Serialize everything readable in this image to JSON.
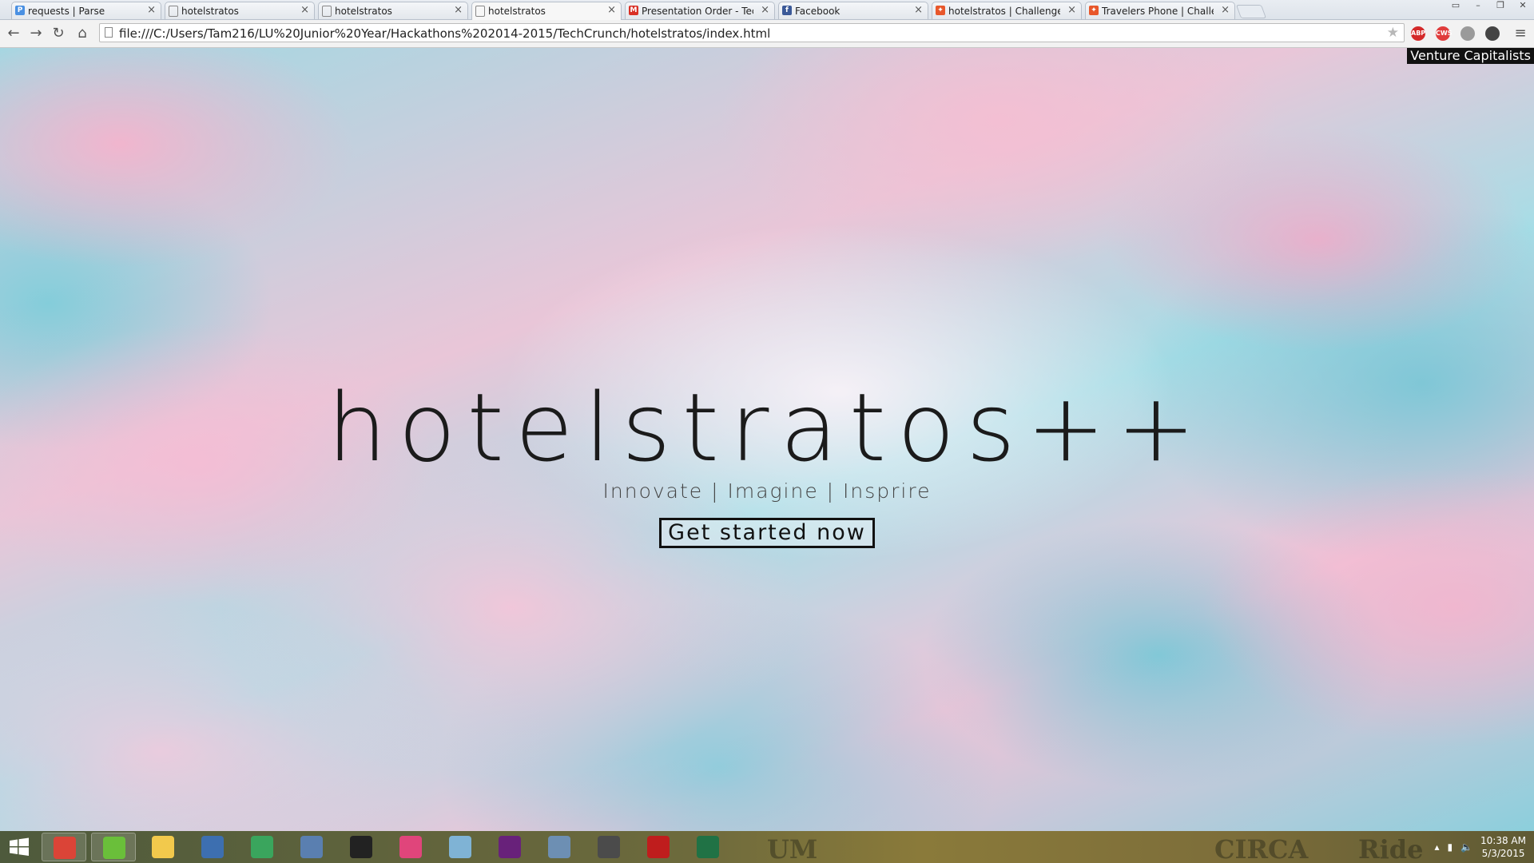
{
  "tabs": [
    {
      "title": "requests | Parse",
      "favicon": "parse-icon",
      "color": "#4a90e2",
      "glyph": "P"
    },
    {
      "title": "hotelstratos",
      "favicon": "page-icon",
      "color": "#888888",
      "glyph": ""
    },
    {
      "title": "hotelstratos",
      "favicon": "page-icon",
      "color": "#888888",
      "glyph": ""
    },
    {
      "title": "hotelstratos",
      "favicon": "page-icon",
      "color": "#888888",
      "glyph": "",
      "active": true
    },
    {
      "title": "Presentation Order - Tech",
      "favicon": "gmail-icon",
      "color": "#d93025",
      "glyph": "M"
    },
    {
      "title": "Facebook",
      "favicon": "facebook-icon",
      "color": "#3b5998",
      "glyph": "f"
    },
    {
      "title": "hotelstratos | ChallengePo",
      "favicon": "challengepost-icon",
      "color": "#e8572b",
      "glyph": "✦"
    },
    {
      "title": "Travelers Phone | Challeng",
      "favicon": "challengepost-icon",
      "color": "#e8572b",
      "glyph": "✦"
    }
  ],
  "toolbar": {
    "url": "file:///C:/Users/Tam216/LU%20Junior%20Year/Hackathons%202014-2015/TechCrunch/hotelstratos/index.html",
    "back": "←",
    "forward": "→",
    "reload": "↻",
    "home": "⌂",
    "star": "★",
    "menu": "≡",
    "extensions": [
      {
        "name": "adblock-icon",
        "label": "ABP",
        "color": "#d42a2a"
      },
      {
        "name": "extension-red-icon",
        "label": "CWS",
        "color": "#e03c3c"
      },
      {
        "name": "extension-grey-icon",
        "label": "",
        "color": "#9a9a9a"
      },
      {
        "name": "extension-dark-icon",
        "label": "",
        "color": "#444444"
      }
    ]
  },
  "tooltip": "Venture Capitalists",
  "hero": {
    "title": "hotelstratos++",
    "tagline": "Innovate | Imagine | Insprire",
    "cta": "Get started now"
  },
  "taskbar": {
    "apps": [
      {
        "name": "chrome-taskbar-icon",
        "color": "#db4437"
      },
      {
        "name": "clover-taskbar-icon",
        "color": "#6abf3a"
      },
      {
        "name": "file-explorer-taskbar-icon",
        "color": "#f2c94c"
      },
      {
        "name": "network-taskbar-icon",
        "color": "#3d6fb0"
      },
      {
        "name": "media-center-taskbar-icon",
        "color": "#3aa55d"
      },
      {
        "name": "virtualbox-taskbar-icon",
        "color": "#5a7fb0"
      },
      {
        "name": "terminal-taskbar-icon",
        "color": "#222222"
      },
      {
        "name": "itunes-taskbar-icon",
        "color": "#e0457b"
      },
      {
        "name": "notepad-taskbar-icon",
        "color": "#7fb3d5"
      },
      {
        "name": "visual-studio-taskbar-icon",
        "color": "#68217a"
      },
      {
        "name": "image-viewer-taskbar-icon",
        "color": "#6d8fb3"
      },
      {
        "name": "sublime-text-taskbar-icon",
        "color": "#4b4b4b"
      },
      {
        "name": "filezilla-taskbar-icon",
        "color": "#bf1d1d"
      },
      {
        "name": "excel-taskbar-icon",
        "color": "#207245"
      }
    ],
    "time": "10:38 AM",
    "date": "5/3/2015"
  }
}
